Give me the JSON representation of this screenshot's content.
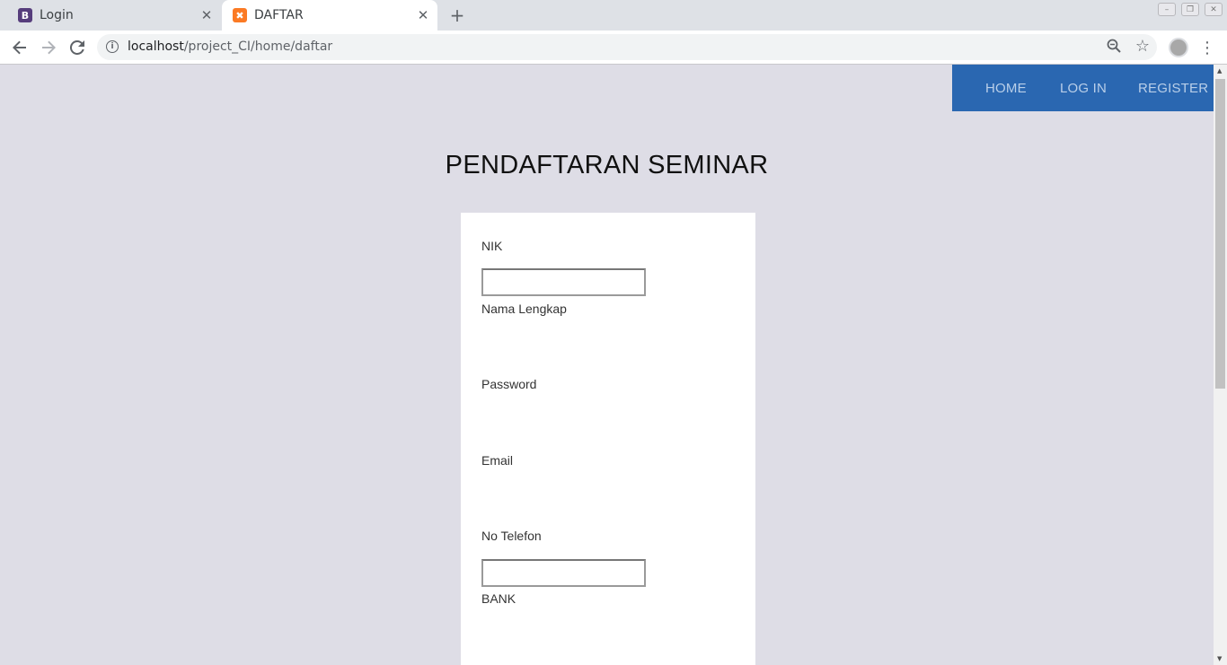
{
  "browser": {
    "tabs": [
      {
        "title": "Login",
        "icon": "bootstrap-icon",
        "active": false
      },
      {
        "title": "DAFTAR",
        "icon": "xampp-icon",
        "active": true
      }
    ],
    "url_host": "localhost",
    "url_path": "/project_CI/home/daftar"
  },
  "nav": {
    "home": "HOME",
    "login": "LOG IN",
    "register": "REGISTER"
  },
  "page_title": "PENDAFTARAN SEMINAR",
  "form": {
    "nik_label": "NIK",
    "nik_value": "",
    "nama_label": "Nama Lengkap",
    "password_label": "Password",
    "email_label": "Email",
    "telefon_label": "No Telefon",
    "telefon_value": "",
    "bank_label": "BANK"
  },
  "colors": {
    "nav_bg": "#2a67b1",
    "page_bg": "#dedde6",
    "card_bg": "#ffffff"
  }
}
